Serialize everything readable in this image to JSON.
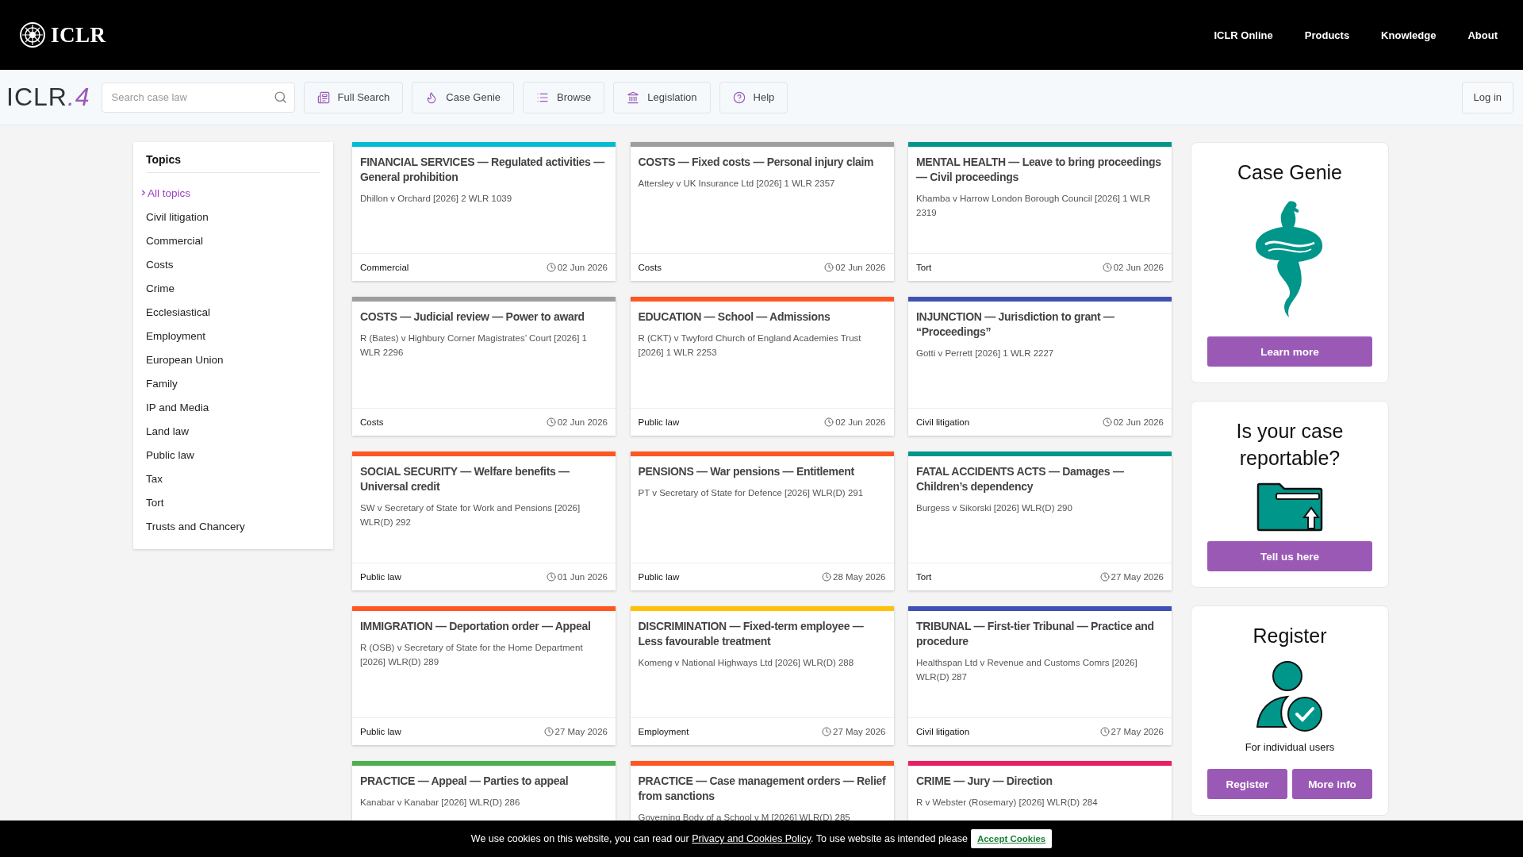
{
  "top_nav": {
    "brand": "ICLR",
    "links": [
      "ICLR Online",
      "Products",
      "Knowledge",
      "About"
    ]
  },
  "toolbar": {
    "logo": "ICLR",
    "logo_suffix": ".4",
    "search": {
      "placeholder": "Search case law"
    },
    "buttons": [
      {
        "kind": "full-search",
        "label": "Full Search"
      },
      {
        "kind": "genie",
        "label": "Case Genie"
      },
      {
        "kind": "browse",
        "label": "Browse"
      },
      {
        "kind": "legislation",
        "label": "Legislation"
      },
      {
        "kind": "help",
        "label": "Help"
      }
    ],
    "login": "Log in"
  },
  "topics": {
    "title": "Topics",
    "items": [
      {
        "label": "All topics",
        "selected": true
      },
      {
        "label": "Civil litigation",
        "selected": false
      },
      {
        "label": "Commercial",
        "selected": false
      },
      {
        "label": "Costs",
        "selected": false
      },
      {
        "label": "Crime",
        "selected": false
      },
      {
        "label": "Ecclesiastical",
        "selected": false
      },
      {
        "label": "Employment",
        "selected": false
      },
      {
        "label": "European Union",
        "selected": false
      },
      {
        "label": "Family",
        "selected": false
      },
      {
        "label": "IP and Media",
        "selected": false
      },
      {
        "label": "Land law",
        "selected": false
      },
      {
        "label": "Public law",
        "selected": false
      },
      {
        "label": "Tax",
        "selected": false
      },
      {
        "label": "Tort",
        "selected": false
      },
      {
        "label": "Trusts and Chancery",
        "selected": false
      }
    ]
  },
  "cases": [
    {
      "title": "FINANCIAL SERVICES — Regulated activities — General prohibition",
      "citation": "Dhillon v Orchard [2026] 2 WLR 1039",
      "topic": "Commercial",
      "date": "02 Jun 2026",
      "color": "#00bcd4"
    },
    {
      "title": "COSTS — Fixed costs — Personal injury claim",
      "citation": "Attersley v UK Insurance Ltd [2026] 1 WLR 2357",
      "topic": "Costs",
      "date": "02 Jun 2026",
      "color": "#9e9e9e"
    },
    {
      "title": "MENTAL HEALTH — Leave to bring proceedings — Civil proceedings",
      "citation": "Khamba v Harrow London Borough Council [2026] 1 WLR 2319",
      "topic": "Tort",
      "date": "02 Jun 2026",
      "color": "#009688"
    },
    {
      "title": "COSTS — Judicial review — Power to award",
      "citation": "R (Bates) v Highbury Corner Magistrates’ Court [2026] 1 WLR 2296",
      "topic": "Costs",
      "date": "02 Jun 2026",
      "color": "#9e9e9e"
    },
    {
      "title": "EDUCATION — School — Admissions",
      "citation": "R (CKT) v Twyford Church of England Academies Trust [2026] 1 WLR 2253",
      "topic": "Public law",
      "date": "02 Jun 2026",
      "color": "#ff5722"
    },
    {
      "title": "INJUNCTION — Jurisdiction to grant — “Proceedings”",
      "citation": "Gotti v Perrett [2026] 1 WLR 2227",
      "topic": "Civil litigation",
      "date": "02 Jun 2026",
      "color": "#3f51b5"
    },
    {
      "title": "SOCIAL SECURITY — Welfare benefits — Universal credit",
      "citation": "SW v Secretary of State for Work and Pensions [2026] WLR(D) 292",
      "topic": "Public law",
      "date": "01 Jun 2026",
      "color": "#ff5722"
    },
    {
      "title": "PENSIONS — War pensions — Entitlement",
      "citation": "PT v Secretary of State for Defence [2026] WLR(D) 291",
      "topic": "Public law",
      "date": "28 May 2026",
      "color": "#ff5722"
    },
    {
      "title": "FATAL ACCIDENTS ACTS — Damages — Children’s dependency",
      "citation": "Burgess v Sikorski [2026] WLR(D) 290",
      "topic": "Tort",
      "date": "27 May 2026",
      "color": "#009688"
    },
    {
      "title": "IMMIGRATION — Deportation order — Appeal",
      "citation": "R (OSB) v Secretary of State for the Home Department [2026] WLR(D) 289",
      "topic": "Public law",
      "date": "27 May 2026",
      "color": "#ff5722"
    },
    {
      "title": "DISCRIMINATION — Fixed-term employee — Less favourable treatment",
      "citation": "Komeng v National Highways Ltd [2026] WLR(D) 288",
      "topic": "Employment",
      "date": "27 May 2026",
      "color": "#ffc107"
    },
    {
      "title": "TRIBUNAL — First-tier Tribunal — Practice and procedure",
      "citation": "Healthspan Ltd v Revenue and Customs Comrs [2026] WLR(D) 287",
      "topic": "Civil litigation",
      "date": "27 May 2026",
      "color": "#3f51b5"
    },
    {
      "title": "PRACTICE — Appeal — Parties to appeal",
      "citation": "Kanabar v Kanabar [2026] WLR(D) 286",
      "color": "#4caf50"
    },
    {
      "title": "PRACTICE — Case management orders — Relief from sanctions",
      "citation": "Governing Body of a School v M [2026] WLR(D) 285",
      "color": "#ff5722"
    },
    {
      "title": "CRIME — Jury — Direction",
      "citation": "R v Webster (Rosemary) [2026] WLR(D) 284",
      "color": "#e91e63"
    }
  ],
  "promos": [
    {
      "kind": "genie",
      "title": "Case Genie",
      "buttons": [
        "Learn more"
      ]
    },
    {
      "kind": "folder",
      "title": "Is your case reportable?",
      "buttons": [
        "Tell us here"
      ]
    },
    {
      "kind": "person",
      "title": "Register",
      "caption": "For individual users",
      "buttons": [
        "Register",
        "More info"
      ]
    }
  ],
  "cookie_bar": {
    "text_before": "We use cookies on this website, you can read our ",
    "link": "Privacy and Cookies Policy",
    "text_after": ". To use website as intended please",
    "button": "Accept Cookies"
  }
}
